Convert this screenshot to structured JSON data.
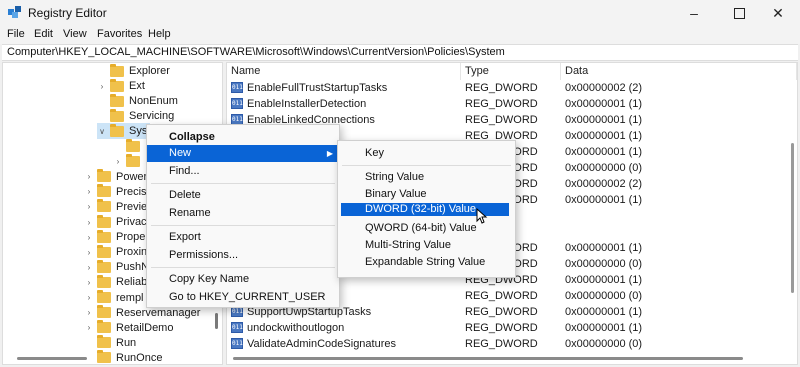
{
  "window": {
    "title": "Registry Editor",
    "minimize_icon": "minimize-icon",
    "maximize_icon": "maximize-icon",
    "close_icon": "close-icon"
  },
  "menu": [
    "File",
    "Edit",
    "View",
    "Favorites",
    "Help"
  ],
  "address": "Computer\\HKEY_LOCAL_MACHINE\\SOFTWARE\\Microsoft\\Windows\\CurrentVersion\\Policies\\System",
  "tree": [
    {
      "label": "Explorer",
      "chevron": "",
      "selected": false
    },
    {
      "label": "Ext",
      "chevron": ">",
      "selected": false
    },
    {
      "label": "NonEnum",
      "chevron": "",
      "selected": false
    },
    {
      "label": "Servicing",
      "chevron": "",
      "selected": false
    },
    {
      "label": "Syst",
      "chevron": "v",
      "selected": true
    },
    {
      "label": "",
      "chevron": "",
      "selected": false
    },
    {
      "label": "",
      "chevron": ">",
      "selected": false
    },
    {
      "label": "Power",
      "chevron": ">",
      "selected": false
    },
    {
      "label": "Precis",
      "chevron": ">",
      "selected": false
    },
    {
      "label": "Previe",
      "chevron": ">",
      "selected": false
    },
    {
      "label": "Privac",
      "chevron": ">",
      "selected": false
    },
    {
      "label": "Prope",
      "chevron": ">",
      "selected": false
    },
    {
      "label": "Proxin",
      "chevron": ">",
      "selected": false
    },
    {
      "label": "PushN",
      "chevron": ">",
      "selected": false
    },
    {
      "label": "Reliab",
      "chevron": ">",
      "selected": false
    },
    {
      "label": "rempl",
      "chevron": ">",
      "selected": false
    },
    {
      "label": "Reservemanager",
      "chevron": ">",
      "selected": false
    },
    {
      "label": "RetailDemo",
      "chevron": ">",
      "selected": false
    },
    {
      "label": "Run",
      "chevron": "",
      "selected": false
    },
    {
      "label": "RunOnce",
      "chevron": "",
      "selected": false
    }
  ],
  "columns": {
    "name": "Name",
    "type": "Type",
    "data": "Data"
  },
  "values": [
    {
      "name": "EnableFullTrustStartupTasks",
      "type": "REG_DWORD",
      "data": "0x00000002 (2)"
    },
    {
      "name": "EnableInstallerDetection",
      "type": "REG_DWORD",
      "data": "0x00000001 (1)"
    },
    {
      "name": "EnableLinkedConnections",
      "type": "REG_DWORD",
      "data": "0x00000001 (1)"
    },
    {
      "name": "",
      "type": "REG_DWORD",
      "data": "0x00000001 (1)"
    },
    {
      "name": "",
      "type": "REG_DWORD",
      "data": "0x00000001 (1)"
    },
    {
      "name": "",
      "type": "REG_DWORD",
      "data": "0x00000000 (0)"
    },
    {
      "name": "",
      "type": "REG_DWORD",
      "data": "0x00000002 (2)"
    },
    {
      "name": "",
      "type": "REG_DWORD",
      "data": "0x00000001 (1)"
    },
    {
      "name": "",
      "type": "",
      "data": ""
    },
    {
      "name": "",
      "type": "",
      "data": ""
    },
    {
      "name": "",
      "type": "REG_DWORD",
      "data": "0x00000001 (1)"
    },
    {
      "name": "",
      "type": "REG_DWORD",
      "data": "0x00000000 (0)"
    },
    {
      "name": "on",
      "type": "REG_DWORD",
      "data": "0x00000001 (1)"
    },
    {
      "name": "upTasks",
      "type": "REG_DWORD",
      "data": "0x00000000 (0)"
    },
    {
      "name": "SupportUwpStartupTasks",
      "type": "REG_DWORD",
      "data": "0x00000001 (1)"
    },
    {
      "name": "undockwithoutlogon",
      "type": "REG_DWORD",
      "data": "0x00000001 (1)"
    },
    {
      "name": "ValidateAdminCodeSignatures",
      "type": "REG_DWORD",
      "data": "0x00000000 (0)"
    }
  ],
  "context_menu": {
    "items": [
      "Collapse",
      "New",
      "Find...",
      "Delete",
      "Rename",
      "Export",
      "Permissions...",
      "Copy Key Name",
      "Go to HKEY_CURRENT_USER"
    ],
    "highlighted": "New"
  },
  "submenu": {
    "items": [
      "Key",
      "String Value",
      "Binary Value",
      "DWORD (32-bit) Value",
      "QWORD (64-bit) Value",
      "Multi-String Value",
      "Expandable String Value"
    ],
    "highlighted": "DWORD (32-bit) Value"
  },
  "colors": {
    "highlight": "#0a64d6",
    "folder": "#f0c14b",
    "selection": "#cce4f7"
  }
}
